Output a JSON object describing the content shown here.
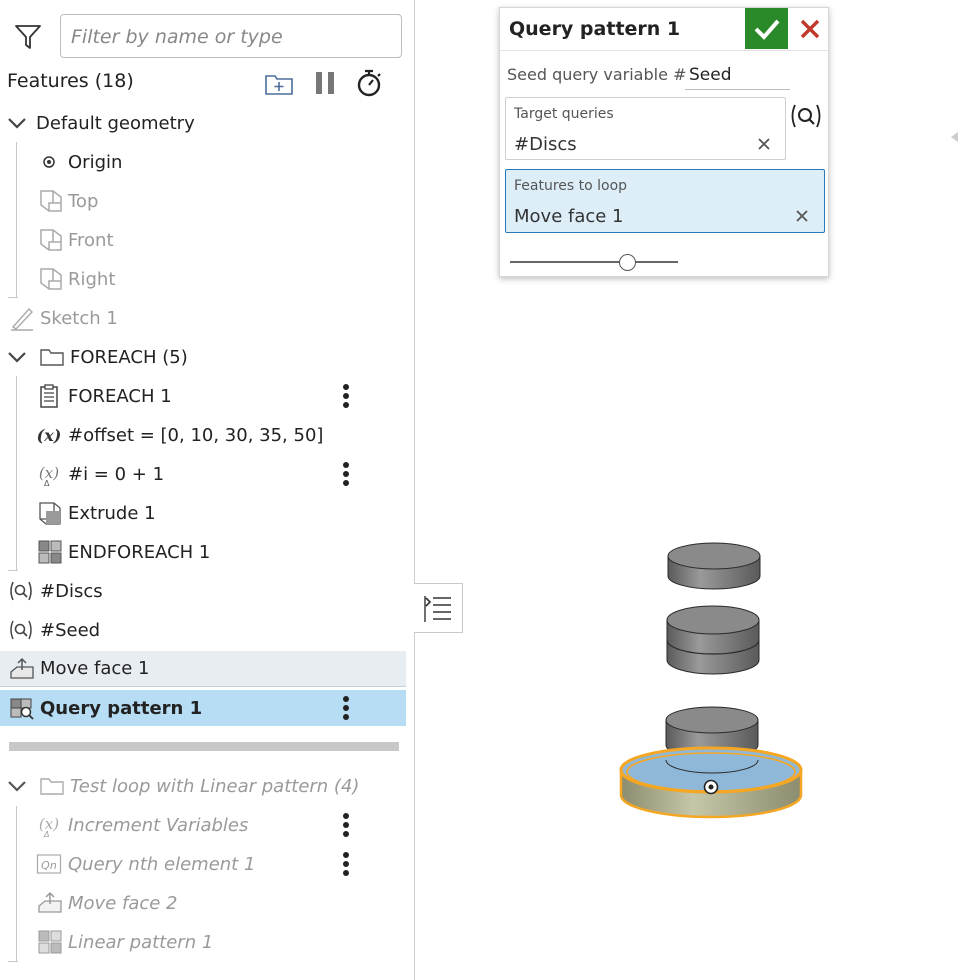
{
  "filter": {
    "placeholder": "Filter by name or type"
  },
  "header": {
    "title": "Features (18)"
  },
  "tree": {
    "default_geometry": "Default geometry",
    "origin": "Origin",
    "top": "Top",
    "front": "Front",
    "right": "Right",
    "sketch1": "Sketch 1",
    "foreach_folder": "FOREACH (5)",
    "foreach1": "FOREACH 1",
    "offset_var": "#offset = [0, 10, 30, 35, 50]",
    "i_var": "#i = 0 + 1",
    "extrude1": "Extrude 1",
    "endforeach1": "ENDFOREACH 1",
    "discs": "#Discs",
    "seed": "#Seed",
    "move_face1": "Move face 1",
    "query_pattern1": "Query pattern 1",
    "test_loop_folder": "Test loop with Linear pattern (4)",
    "increment_vars": "Increment Variables",
    "query_nth": "Query nth element 1",
    "move_face2": "Move face 2",
    "linear_pattern1": "Linear pattern 1"
  },
  "dialog": {
    "title": "Query pattern 1",
    "seed_label": "Seed query variable #",
    "seed_value": "Seed",
    "target_label": "Target queries",
    "target_value": "#Discs",
    "loop_label": "Features to loop",
    "loop_value": "Move face 1",
    "slider_fraction": 0.7
  },
  "colors": {
    "selected_row": "#b6ddf3",
    "ok_green": "#2a8a2a",
    "cancel_red": "#c0392b",
    "highlight_orange": "#f5a623"
  }
}
